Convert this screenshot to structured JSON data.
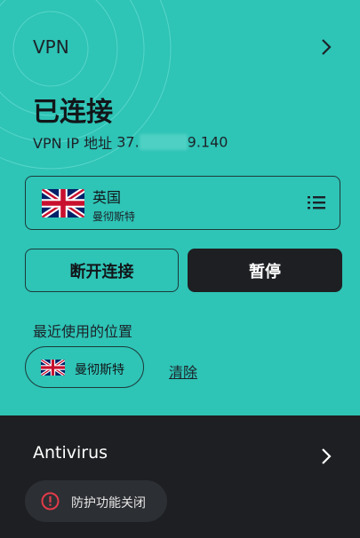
{
  "vpn": {
    "label": "VPN",
    "status_title": "已连接",
    "ip_label": "VPN IP 地址",
    "ip_prefix": "37.",
    "ip_suffix": "9.140",
    "location": {
      "country": "英国",
      "city": "曼彻斯特",
      "flag": "uk-flag-icon"
    },
    "disconnect_label": "断开连接",
    "pause_label": "暂停",
    "recent_heading": "最近使用的位置",
    "recent_items": [
      {
        "label": "曼彻斯特",
        "flag": "uk-flag-icon"
      }
    ],
    "clear_label": "清除"
  },
  "antivirus": {
    "title": "Antivirus",
    "status_label": "防护功能关闭",
    "status_icon": "info-circle-icon"
  },
  "colors": {
    "vpn_bg": "#2ec4b6",
    "dark_bg": "#1d1f22",
    "chip_bg": "#2c2f33",
    "alert_red": "#e23b4a"
  }
}
